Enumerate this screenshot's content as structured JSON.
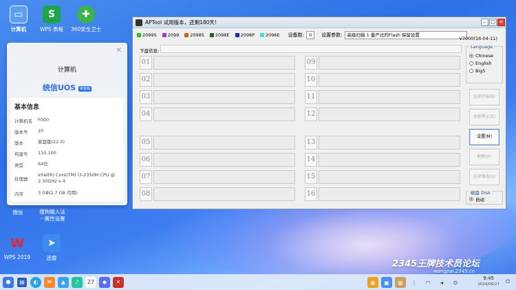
{
  "desktop": {
    "icons": [
      {
        "label": "计算机"
      },
      {
        "label": "WPS 表格"
      },
      {
        "label": "360安全卫士"
      },
      {
        "label": "微信"
      },
      {
        "label": "搜狗输入法\n···属性设置"
      },
      {
        "label": "WPS 2019"
      },
      {
        "label": "迅雷"
      }
    ]
  },
  "sysinfo": {
    "title": "计算机",
    "logo": "统信UOS",
    "logo_badge": "家庭版",
    "section": "基本信息",
    "rows": [
      {
        "k": "计算机名",
        "v": "F000"
      },
      {
        "k": "版本号",
        "v": "20"
      },
      {
        "k": "版本",
        "v": "家庭版(22.0)"
      },
      {
        "k": "构建号",
        "v": "110.100"
      },
      {
        "k": "类型",
        "v": "64位"
      },
      {
        "k": "处理器",
        "v": "Intel(R) Core(TM) i3-2350M CPU @ 2.30GHz x 4"
      },
      {
        "k": "内存",
        "v": "3 GB(2.7 GB 可用)"
      }
    ]
  },
  "aptool": {
    "title": "APTool  试用版本，还剩180天!",
    "legend": [
      {
        "label": "2099S",
        "color": "#1ec81e"
      },
      {
        "label": "2099",
        "color": "#a040d0"
      },
      {
        "label": "2098S",
        "color": "#c86414"
      },
      {
        "label": "2098E",
        "color": "#1e6428"
      },
      {
        "label": "2098P",
        "color": "#1e28c8"
      },
      {
        "label": "2096E",
        "color": "#40e0e0"
      }
    ],
    "device_count_label": "设备数:",
    "device_count": "0",
    "param_label": "设置参数:",
    "param_value": "高级扫描 1 量产过的Flash 保留设置",
    "version": "V7000(16-04-11)",
    "disk_info_label": "下盘信息:",
    "slots": [
      "01",
      "02",
      "03",
      "04",
      "05",
      "06",
      "07",
      "08",
      "09",
      "10",
      "11",
      "12",
      "13",
      "14",
      "15",
      "16"
    ],
    "language": {
      "title": "Language",
      "options": [
        {
          "label": "Chinese",
          "selected": true
        },
        {
          "label": "English",
          "selected": false
        },
        {
          "label": "Big5",
          "selected": false
        }
      ]
    },
    "buttons": [
      {
        "label": "全部开始(B)",
        "enabled": false
      },
      {
        "label": "全部停止(E)",
        "enabled": false
      },
      {
        "label": "设置(M)",
        "enabled": true
      },
      {
        "label": "刷新(R)",
        "enabled": false
      },
      {
        "label": "全部弹出(U)",
        "enabled": false
      }
    ],
    "disk_group": {
      "title": "磁盘 Disk",
      "option": "自动"
    }
  },
  "taskbar": {
    "time": "9:45",
    "date": "2024/05/27"
  },
  "watermark": {
    "brand": "2345王牌技术员论坛",
    "url": "wangpai.2345.cn"
  }
}
